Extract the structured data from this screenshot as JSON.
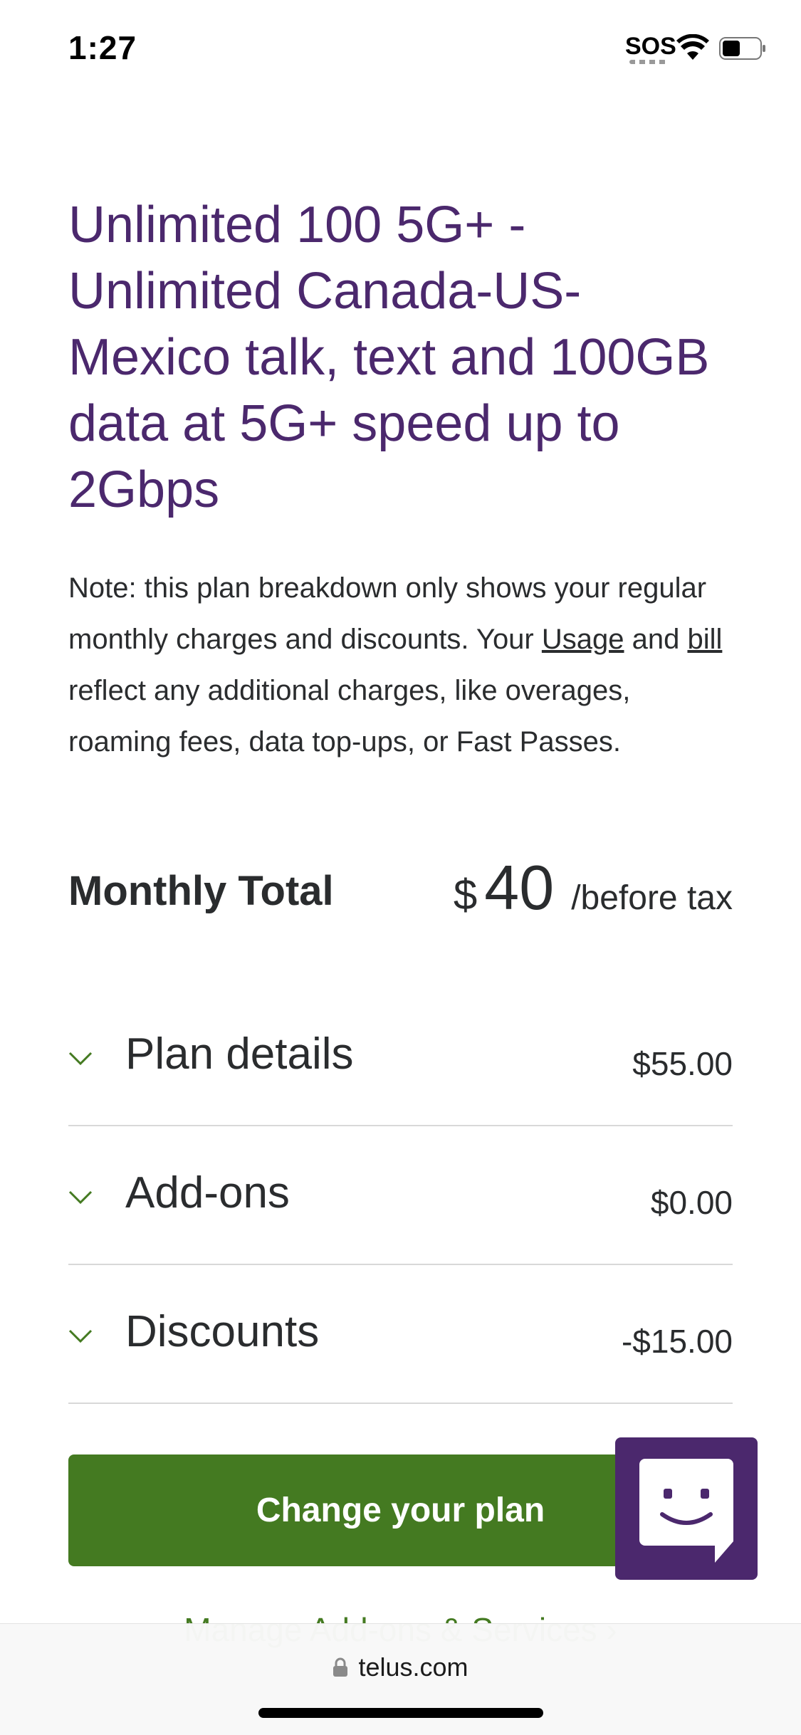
{
  "status_bar": {
    "time": "1:27",
    "sos": "SOS"
  },
  "plan": {
    "title": "Unlimited 100 5G+ - Unlimited Canada-US-Mexico talk, text and 100GB data at 5G+ speed up to 2Gbps",
    "note_prefix": "Note: this plan breakdown only shows your regular monthly charges and discounts. Your ",
    "note_usage_link": "Usage",
    "note_and": " and ",
    "note_bill_link": "bill",
    "note_suffix": " reflect any additional charges, like overages, roaming fees, data top-ups, or Fast Passes."
  },
  "monthly_total": {
    "label": "Monthly Total",
    "currency": "$",
    "amount": "40",
    "suffix": "/before tax"
  },
  "breakdown": [
    {
      "label": "Plan details",
      "amount": "$55.00"
    },
    {
      "label": "Add-ons",
      "amount": "$0.00"
    },
    {
      "label": "Discounts",
      "amount": "-$15.00"
    }
  ],
  "actions": {
    "change_plan": "Change your plan",
    "manage_addons": "Manage Add-ons & Services ›"
  },
  "browser": {
    "url": "telus.com"
  },
  "colors": {
    "brand_purple": "#4b286d",
    "brand_green": "#447a21"
  },
  "icons": {
    "chevron": "chevron-down-icon",
    "chat": "chat-bot-icon",
    "lock": "lock-icon"
  }
}
